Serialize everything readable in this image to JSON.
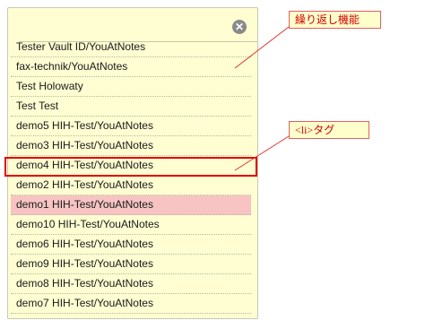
{
  "popup": {
    "close_label": "✕",
    "items": [
      "Tester Vault ID/YouAtNotes",
      "fax-technik/YouAtNotes",
      "Test Holowaty",
      "Test Test",
      "demo5 HIH-Test/YouAtNotes",
      "demo3 HIH-Test/YouAtNotes",
      "demo4 HIH-Test/YouAtNotes",
      "demo2 HIH-Test/YouAtNotes",
      "demo1 HIH-Test/YouAtNotes",
      "demo10 HIH-Test/YouAtNotes",
      "demo6 HIH-Test/YouAtNotes",
      "demo9 HIH-Test/YouAtNotes",
      "demo8 HIH-Test/YouAtNotes",
      "demo7 HIH-Test/YouAtNotes"
    ],
    "highlighted_item": "demo1 HIH-Test/YouAtNotes",
    "framed_item": "demo4 HIH-Test/YouAtNotes"
  },
  "annotations": {
    "repeat_label": "繰り返し機能",
    "li_label": "<li>タグ"
  },
  "colors": {
    "panel_background": "#fefed2",
    "highlight_background": "#f7c3c3",
    "frame_red": "#e00000",
    "callout_text": "#d00000"
  }
}
